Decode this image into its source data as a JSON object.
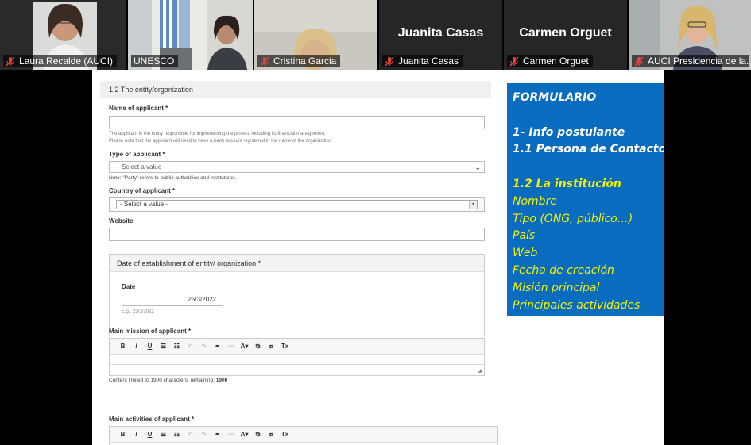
{
  "participants": [
    {
      "name": "Laura Recalde (AUCI)",
      "muted": true,
      "has_video": true
    },
    {
      "name": "UNESCO",
      "muted": false,
      "has_video": true,
      "active_speaker": true
    },
    {
      "name": "Cristina Garcia",
      "muted": true,
      "has_video": true
    },
    {
      "name": "Juanita Casas",
      "muted": true,
      "has_video": false
    },
    {
      "name": "Carmen Orguet",
      "muted": true,
      "has_video": false
    },
    {
      "name": "AUCI Presidencia de la...",
      "muted": true,
      "has_video": true
    }
  ],
  "form": {
    "section_title": "1.2 The entity/organization",
    "name_label": "Name of applicant",
    "required_mark": "*",
    "name_value": "",
    "name_help_1": "The applicant is the entity responsible for implementing the project, including its financial management.",
    "name_help_2": "Please note that the applicant will need to have a bank account registered in the name of the organization.",
    "type_label": "Type of applicant",
    "type_selected": "- Select a value -",
    "type_note": "Note: \"Party\" refers to public authorities and institutions.",
    "country_label": "Country of applicant",
    "country_selected": "- Select a value -",
    "website_label": "Website",
    "website_value": "",
    "establishment_legend": "Date of establishment of entity/ organization",
    "date_label": "Date",
    "date_value": "25/3/2022",
    "date_help": "E.g., 25/3/2022",
    "mission_label": "Main mission of applicant",
    "mission_limit_text": "Content limited to 1900 characters, remaining:",
    "mission_limit_remaining": "1900",
    "activities_label": "Main activities of applicant"
  },
  "editor_toolbar": {
    "bold": "B",
    "italic": "I",
    "underline": "U",
    "bullets": "☰",
    "numbered": "☷",
    "undo": "↶",
    "redo": "↷",
    "link": "⚭",
    "unlink": "⚯",
    "font_color": "A▾",
    "paste": "⧉",
    "paste_text": "⧈",
    "remove_format": "Tx"
  },
  "panel": {
    "bg_color": "#0a6cbf",
    "white_color": "#ffffff",
    "yellow_color": "#f5f200",
    "heading": "FORMULARIO",
    "items_white": [
      "1- Info postulante",
      "1.1 Persona de Contacto"
    ],
    "item_yellow_bold": "1.2 La institución",
    "items_yellow": [
      "Nombre",
      "Tipo (ONG, público…)",
      "País",
      "Web",
      "Fecha de creación",
      "Misión principal",
      "Principales actividades"
    ]
  },
  "colors": {
    "active_speaker": "#7fc241",
    "muted_icon": "#e0453a"
  }
}
